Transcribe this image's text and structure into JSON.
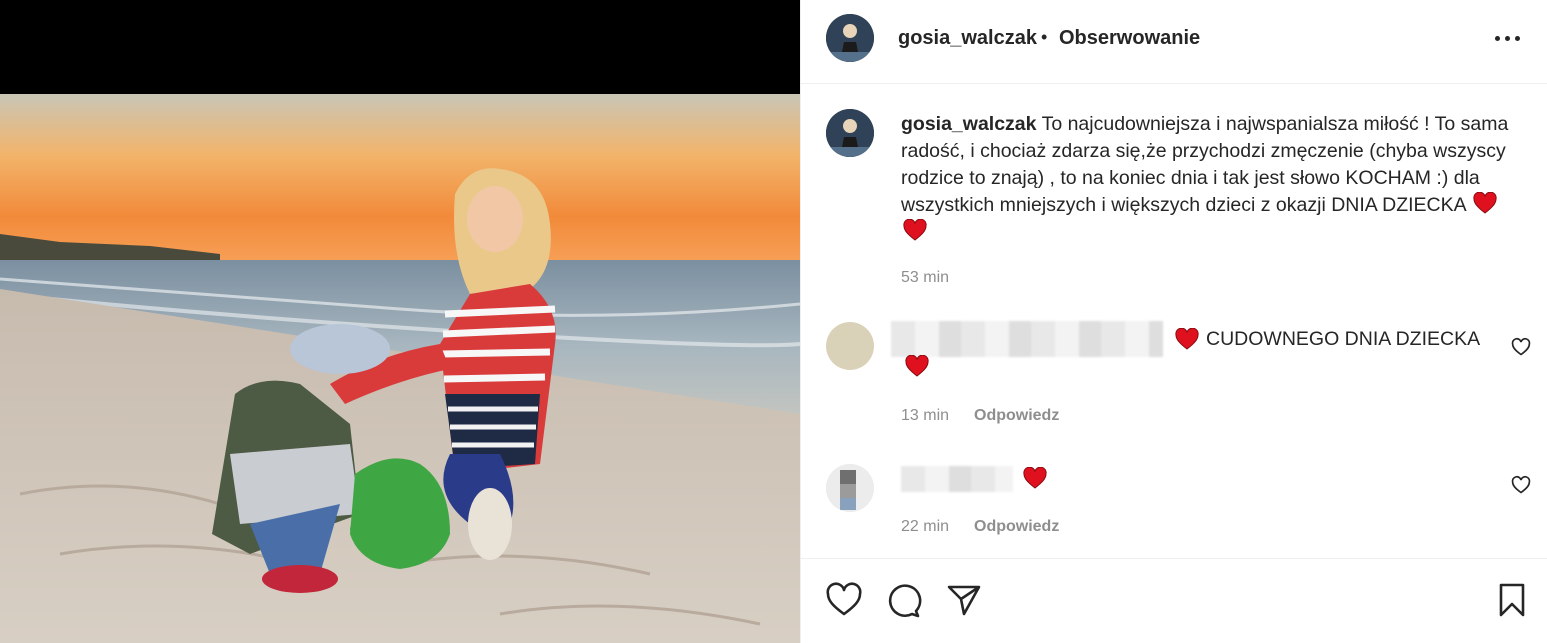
{
  "post": {
    "username": "gosia_walczak",
    "separator": "•",
    "follow_label": "Obserwowanie",
    "more_icon": "more-horizontal-icon"
  },
  "caption": {
    "username": "gosia_walczak",
    "text": "To najcudowniejsza i najwspanialsza miłość ! To sama radość, i chociaż zdarza się,że przychodzi zmęczenie (chyba wszyscy rodzice to znają) , to na koniec dnia i tak jest słowo KOCHAM :) dla wszystkich mniejszych i większych dzieci z okazji DNIA DZIECKA",
    "emoji": "❤️❤️",
    "time": "53 min"
  },
  "comments": [
    {
      "text": "CUDOWNEGO DNIA DZIECKA",
      "time": "13 min",
      "reply_label": "Odpowiedz"
    },
    {
      "text": "",
      "time": "22 min",
      "reply_label": "Odpowiedz"
    }
  ],
  "actions": {
    "like_icon": "heart-icon",
    "comment_icon": "comment-icon",
    "share_icon": "send-icon",
    "save_icon": "bookmark-icon"
  },
  "colors": {
    "heart_red": "#e0111f",
    "text": "#262626",
    "muted": "#8e8e8e"
  }
}
